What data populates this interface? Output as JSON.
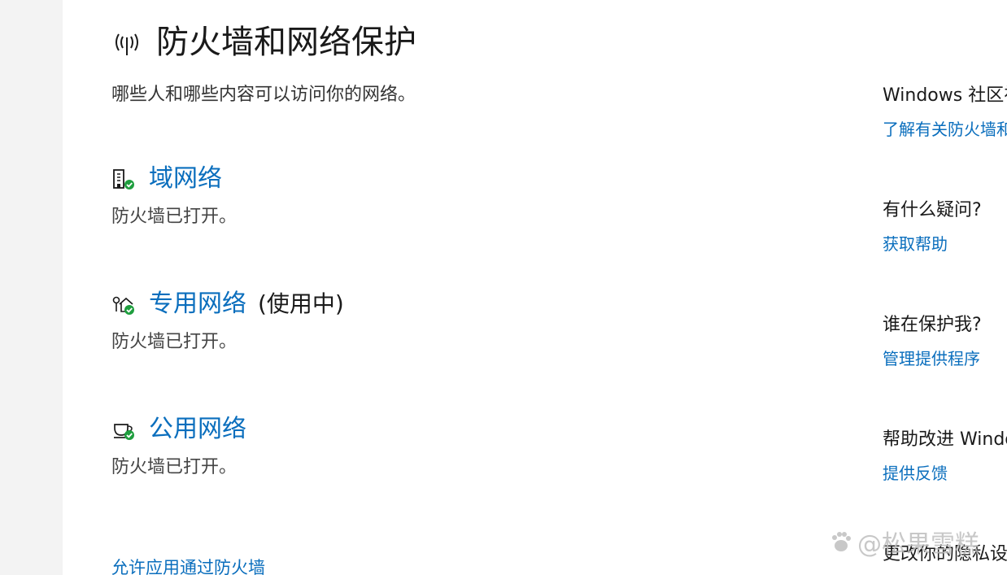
{
  "header": {
    "title": "防火墙和网络保护",
    "subtitle": "哪些人和哪些内容可以访问你的网络。"
  },
  "networks": [
    {
      "name": "域网络",
      "active": "",
      "status": "防火墙已打开。",
      "icon": "domain-network-icon"
    },
    {
      "name": "专用网络",
      "active": "(使用中)",
      "status": "防火墙已打开。",
      "icon": "private-network-icon"
    },
    {
      "name": "公用网络",
      "active": "",
      "status": "防火墙已打开。",
      "icon": "public-network-icon"
    }
  ],
  "links": {
    "allow_app": "允许应用通过防火墙"
  },
  "side": [
    {
      "title": "Windows 社区视",
      "link": "了解有关防火墙和"
    },
    {
      "title": "有什么疑问?",
      "link": "获取帮助"
    },
    {
      "title": "谁在保护我?",
      "link": "管理提供程序"
    },
    {
      "title": "帮助改进 Windo",
      "link": "提供反馈"
    },
    {
      "title": "更改你的隐私设"
    }
  ],
  "watermark": {
    "text": "@松果雪糕"
  },
  "colors": {
    "link": "#0a6ebd",
    "check": "#1e9e3e",
    "left_strip": "#f3f3f3"
  }
}
